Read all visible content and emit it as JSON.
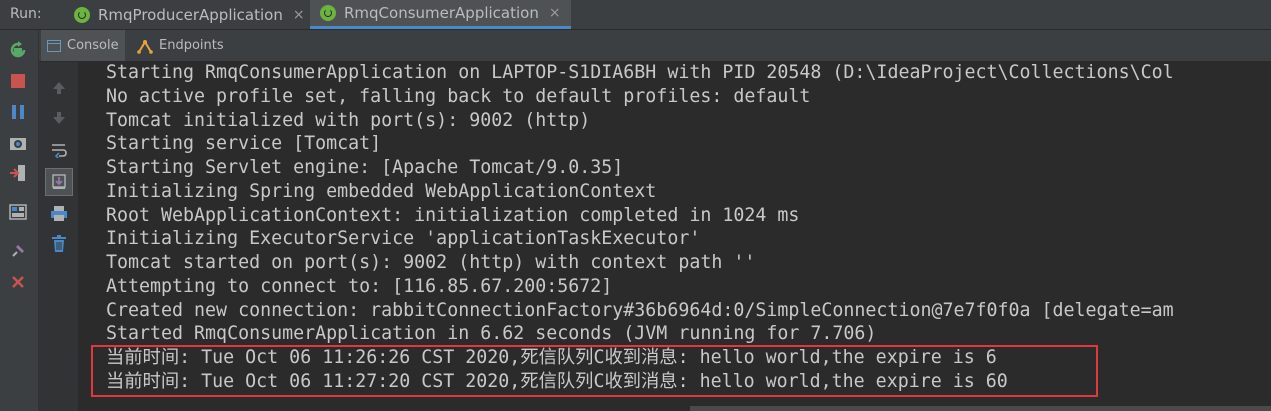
{
  "runbar": {
    "label": "Run:",
    "tabs": [
      {
        "label": "RmqProducerApplication",
        "close": "×",
        "active": false
      },
      {
        "label": "RmqConsumerApplication",
        "close": "×",
        "active": true
      }
    ]
  },
  "subtabs": [
    {
      "label": "Console",
      "active": true
    },
    {
      "label": "Endpoints",
      "active": false
    }
  ],
  "left_toolbar_icons": [
    "rerun-icon",
    "stop-icon",
    "pause-icon",
    "camera-icon",
    "exit-icon",
    "layout-icon",
    "pin-icon",
    "close-icon"
  ],
  "console_toolbar_icons": [
    "up-arrow-icon",
    "down-arrow-icon",
    "soft-wrap-icon",
    "scroll-to-end-icon",
    "print-icon",
    "trash-icon"
  ],
  "colors": {
    "accent": "#4a88c7",
    "highlight_border": "#e0383e",
    "text": "#c8c8c8"
  },
  "console": {
    "lines": [
      "Starting RmqConsumerApplication on LAPTOP-S1DIA6BH with PID 20548 (D:\\IdeaProject\\Collections\\Col",
      "No active profile set, falling back to default profiles: default",
      "Tomcat initialized with port(s): 9002 (http)",
      "Starting service [Tomcat]",
      "Starting Servlet engine: [Apache Tomcat/9.0.35]",
      "Initializing Spring embedded WebApplicationContext",
      "Root WebApplicationContext: initialization completed in 1024 ms",
      "Initializing ExecutorService 'applicationTaskExecutor'",
      "Tomcat started on port(s): 9002 (http) with context path ''",
      "Attempting to connect to: [116.85.67.200:5672]",
      "Created new connection: rabbitConnectionFactory#36b6964d:0/SimpleConnection@7e7f0f0a [delegate=am",
      "Started RmqConsumerApplication in 6.62 seconds (JVM running for 7.706)",
      "当前时间: Tue Oct 06 11:26:26 CST 2020,死信队列C收到消息: hello world,the expire is 6",
      "当前时间: Tue Oct 06 11:27:20 CST 2020,死信队列C收到消息: hello world,the expire is 60"
    ]
  }
}
